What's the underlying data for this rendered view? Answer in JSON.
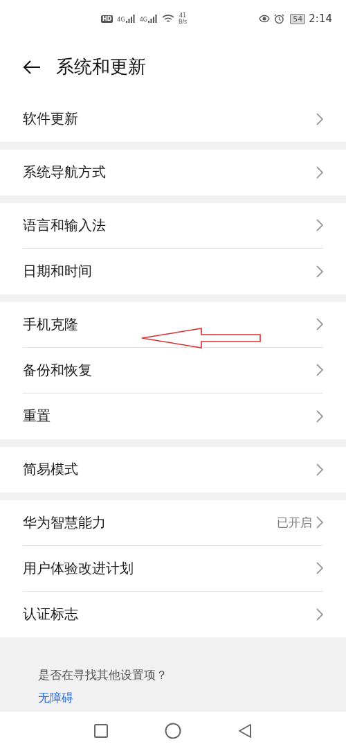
{
  "status_bar": {
    "hd": "HD",
    "sim1": "4G",
    "sim2": "4G",
    "speed": "41",
    "speed_unit": "B/s",
    "battery": "54",
    "time": "2:14"
  },
  "header": {
    "title": "系统和更新"
  },
  "groups": [
    {
      "items": [
        {
          "label": "软件更新",
          "annotated": false
        }
      ]
    },
    {
      "items": [
        {
          "label": "系统导航方式",
          "annotated": false
        }
      ]
    },
    {
      "items": [
        {
          "label": "语言和输入法",
          "annotated": false
        },
        {
          "label": "日期和时间",
          "annotated": false
        }
      ]
    },
    {
      "items": [
        {
          "label": "手机克隆",
          "annotated": true
        },
        {
          "label": "备份和恢复",
          "annotated": false
        },
        {
          "label": "重置",
          "annotated": false
        }
      ]
    },
    {
      "items": [
        {
          "label": "简易模式",
          "annotated": false
        }
      ]
    },
    {
      "items": [
        {
          "label": "华为智慧能力",
          "value": "已开启",
          "annotated": false
        },
        {
          "label": "用户体验改进计划",
          "annotated": false
        },
        {
          "label": "认证标志",
          "annotated": false
        }
      ]
    }
  ],
  "suggestion_card": {
    "question": "是否在寻找其他设置项？",
    "link": "无障碍"
  }
}
